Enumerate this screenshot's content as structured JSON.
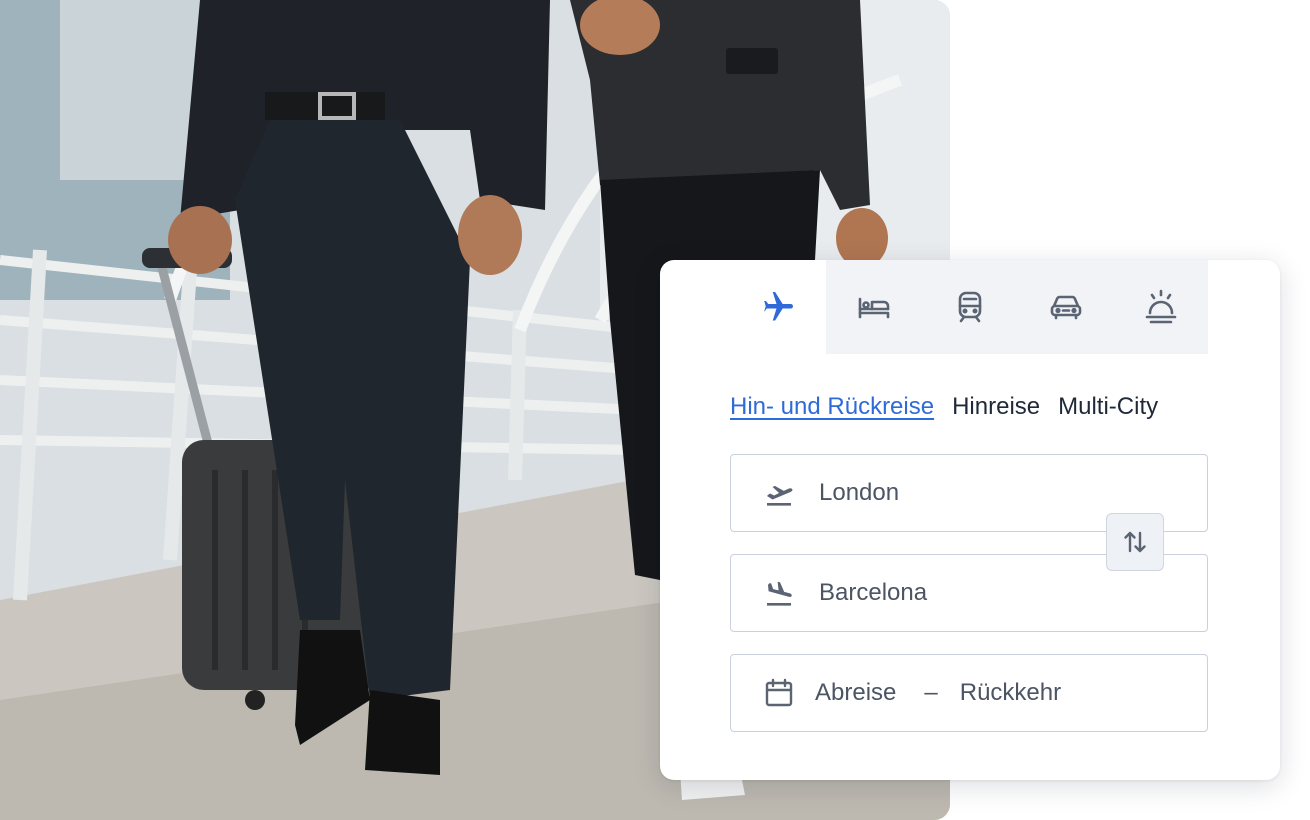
{
  "photo": {
    "description_icon": "business-travelers-photo"
  },
  "booking": {
    "tabs": [
      {
        "icon": "plane-icon",
        "active": true
      },
      {
        "icon": "bed-icon",
        "active": false
      },
      {
        "icon": "train-icon",
        "active": false
      },
      {
        "icon": "car-icon",
        "active": false
      },
      {
        "icon": "concierge-bell-icon",
        "active": false
      }
    ],
    "trip_types": {
      "round_trip": "Hin- und Rückreise",
      "one_way": "Hinreise",
      "multi_city": "Multi-City",
      "selected": "round_trip"
    },
    "from": {
      "value": "London",
      "icon": "takeoff-icon"
    },
    "to": {
      "value": "Barcelona",
      "icon": "landing-icon"
    },
    "dates": {
      "departure": "Abreise",
      "separator": "–",
      "return": "Rückkehr",
      "icon": "calendar-icon"
    },
    "swap_icon": "swap-icon"
  },
  "colors": {
    "accent": "#2f6bd8",
    "icon_gray": "#5b6472",
    "border": "#c9d1dc",
    "tab_bg": "#f1f3f7"
  }
}
